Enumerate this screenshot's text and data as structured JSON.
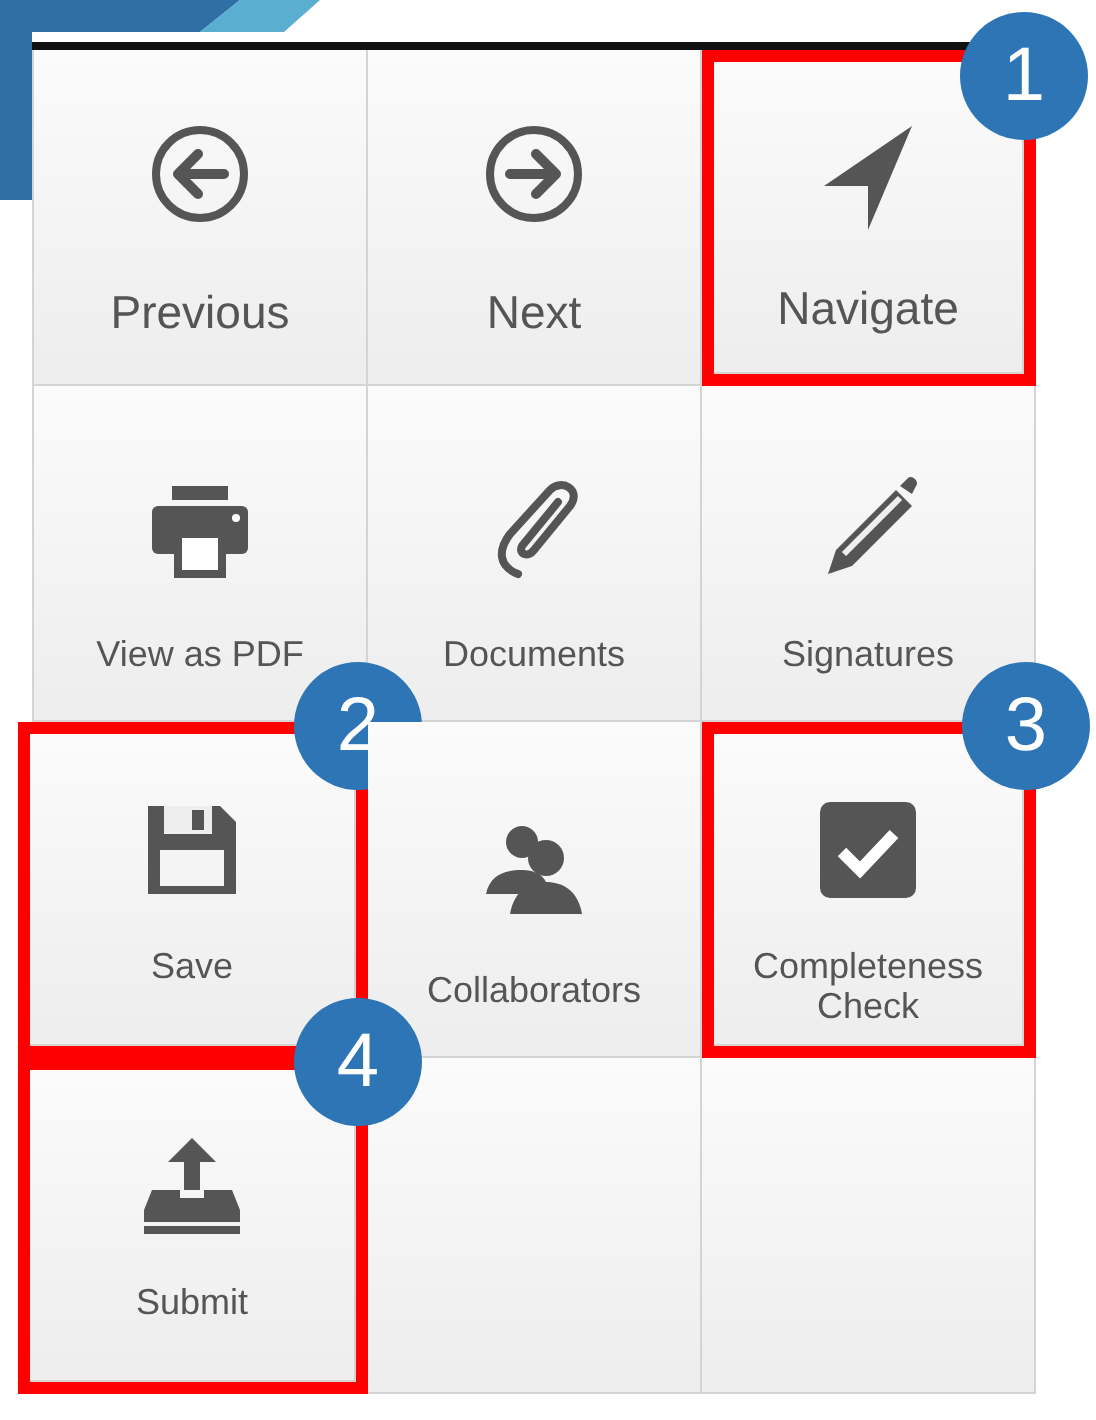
{
  "buttons": [
    {
      "label": "Previous"
    },
    {
      "label": "Next"
    },
    {
      "label": "Navigate",
      "callout": "1"
    },
    {
      "label": "View as PDF"
    },
    {
      "label": "Documents"
    },
    {
      "label": "Signatures"
    },
    {
      "label": "Save",
      "callout": "2"
    },
    {
      "label": "Collaborators"
    },
    {
      "label": "Completeness Check",
      "callout": "3"
    },
    {
      "label": "Submit",
      "callout": "4"
    }
  ]
}
